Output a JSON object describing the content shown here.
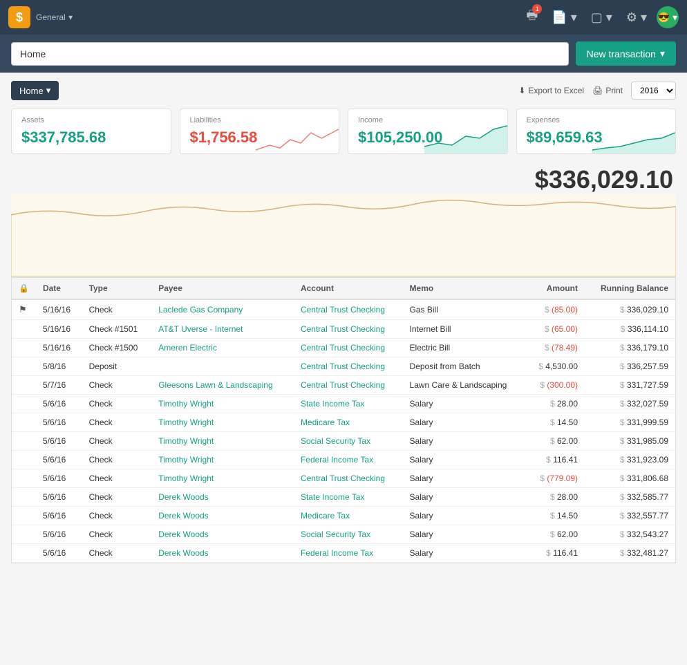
{
  "app": {
    "name": "General",
    "logo": "$"
  },
  "nav": {
    "badge_count": "1"
  },
  "search": {
    "placeholder": "Home",
    "value": "Home"
  },
  "buttons": {
    "new_transaction": "New transaction",
    "home": "Home",
    "export": "Export to Excel",
    "print": "Print"
  },
  "year": "2016",
  "summary": {
    "assets_label": "Assets",
    "assets_value": "$337,785.68",
    "liabilities_label": "Liabilities",
    "liabilities_value": "$1,756.58",
    "income_label": "Income",
    "income_value": "$105,250.00",
    "expenses_label": "Expenses",
    "expenses_value": "$89,659.63"
  },
  "total": "$336,029.10",
  "table": {
    "headers": [
      "",
      "Date",
      "Type",
      "Payee",
      "Account",
      "Memo",
      "Amount",
      "Running Balance"
    ],
    "rows": [
      {
        "flag": true,
        "date": "5/16/16",
        "type": "Check",
        "payee": "Laclede Gas Company",
        "account": "Central Trust Checking",
        "memo": "Gas Bill",
        "amount_sign": "-",
        "amount": "(85.00)",
        "amount_neg": true,
        "balance": "336,029.10"
      },
      {
        "flag": false,
        "date": "5/16/16",
        "type": "Check #1501",
        "payee": "AT&T Uverse - Internet",
        "account": "Central Trust Checking",
        "memo": "Internet Bill",
        "amount_sign": "-",
        "amount": "(65.00)",
        "amount_neg": true,
        "balance": "336,114.10"
      },
      {
        "flag": false,
        "date": "5/16/16",
        "type": "Check #1500",
        "payee": "Ameren Electric",
        "account": "Central Trust Checking",
        "memo": "Electric Bill",
        "amount_sign": "-",
        "amount": "(78.49)",
        "amount_neg": true,
        "balance": "336,179.10"
      },
      {
        "flag": false,
        "date": "5/8/16",
        "type": "Deposit",
        "payee": "",
        "account": "Central Trust Checking",
        "memo": "Deposit from Batch",
        "amount_sign": "+",
        "amount": "4,530.00",
        "amount_neg": false,
        "balance": "336,257.59"
      },
      {
        "flag": false,
        "date": "5/7/16",
        "type": "Check",
        "payee": "Gleesons Lawn & Landscaping",
        "account": "Central Trust Checking",
        "memo": "Lawn Care & Landscaping",
        "amount_sign": "-",
        "amount": "(300.00)",
        "amount_neg": true,
        "balance": "331,727.59"
      },
      {
        "flag": false,
        "date": "5/6/16",
        "type": "Check",
        "payee": "Timothy Wright",
        "account": "State Income Tax",
        "memo": "Salary",
        "amount_sign": "+",
        "amount": "28.00",
        "amount_neg": false,
        "balance": "332,027.59"
      },
      {
        "flag": false,
        "date": "5/6/16",
        "type": "Check",
        "payee": "Timothy Wright",
        "account": "Medicare Tax",
        "memo": "Salary",
        "amount_sign": "+",
        "amount": "14.50",
        "amount_neg": false,
        "balance": "331,999.59"
      },
      {
        "flag": false,
        "date": "5/6/16",
        "type": "Check",
        "payee": "Timothy Wright",
        "account": "Social Security Tax",
        "memo": "Salary",
        "amount_sign": "+",
        "amount": "62.00",
        "amount_neg": false,
        "balance": "331,985.09"
      },
      {
        "flag": false,
        "date": "5/6/16",
        "type": "Check",
        "payee": "Timothy Wright",
        "account": "Federal Income Tax",
        "memo": "Salary",
        "amount_sign": "+",
        "amount": "116.41",
        "amount_neg": false,
        "balance": "331,923.09"
      },
      {
        "flag": false,
        "date": "5/6/16",
        "type": "Check",
        "payee": "Timothy Wright",
        "account": "Central Trust Checking",
        "memo": "Salary",
        "amount_sign": "-",
        "amount": "(779.09)",
        "amount_neg": true,
        "balance": "331,806.68"
      },
      {
        "flag": false,
        "date": "5/6/16",
        "type": "Check",
        "payee": "Derek Woods",
        "account": "State Income Tax",
        "memo": "Salary",
        "amount_sign": "+",
        "amount": "28.00",
        "amount_neg": false,
        "balance": "332,585.77"
      },
      {
        "flag": false,
        "date": "5/6/16",
        "type": "Check",
        "payee": "Derek Woods",
        "account": "Medicare Tax",
        "memo": "Salary",
        "amount_sign": "+",
        "amount": "14.50",
        "amount_neg": false,
        "balance": "332,557.77"
      },
      {
        "flag": false,
        "date": "5/6/16",
        "type": "Check",
        "payee": "Derek Woods",
        "account": "Social Security Tax",
        "memo": "Salary",
        "amount_sign": "+",
        "amount": "62.00",
        "amount_neg": false,
        "balance": "332,543.27"
      },
      {
        "flag": false,
        "date": "5/6/16",
        "type": "Check",
        "payee": "Derek Woods",
        "account": "Federal Income Tax",
        "memo": "Salary",
        "amount_sign": "+",
        "amount": "116.41",
        "amount_neg": false,
        "balance": "332,481.27"
      }
    ]
  }
}
